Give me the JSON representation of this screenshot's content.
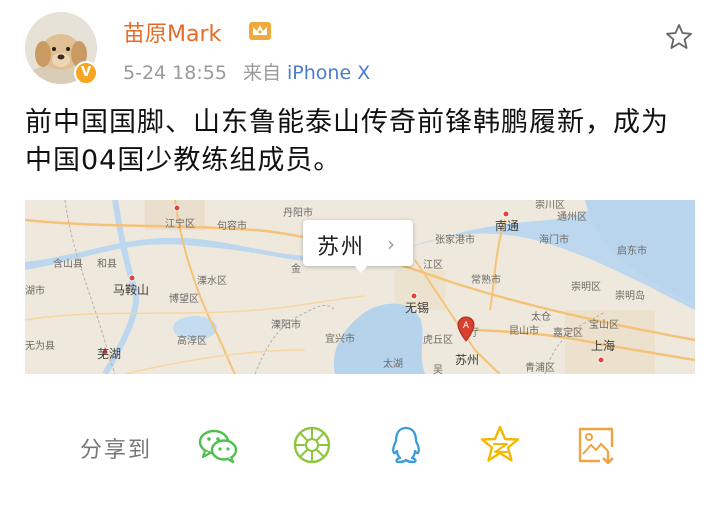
{
  "author": {
    "name": "苗原Mark",
    "verified_badge": "V",
    "badge_color": "#f6a623",
    "name_color": "#e86b24"
  },
  "meta": {
    "time": "5-24 18:55",
    "source_prefix": "来自",
    "source": "iPhone X"
  },
  "post": {
    "text_line1": "前中国国脚、山东鲁能泰山传奇前锋韩鹏履新，成为",
    "text_line2": "中国04国少教练组成员。"
  },
  "map": {
    "location": "苏州",
    "chevron": "›",
    "pin_letter": "A",
    "labels": {
      "nanjing": "江宁区",
      "jurong": "句容市",
      "danyang": "丹阳市",
      "chongchuan": "崇川区",
      "hanshan": "含山县",
      "hexian": "和县",
      "maanshan": "马鞍山",
      "lishui": "溧水区",
      "bowang": "博望区",
      "liyang": "溧阳市",
      "gaochun": "高淳区",
      "wuhu": "芜湖",
      "wuwei": "无为县",
      "hu": "湖市",
      "zhangjiagang": "张家港市",
      "nantong": "南通",
      "haimen": "海门市",
      "qidong": "启东市",
      "tongzhou": "通州区",
      "changshu": "常熟市",
      "wuxi": "无锡",
      "yixing": "宜兴市",
      "taihu": "太湖",
      "huqiu": "虎丘区",
      "suzhou": "苏州",
      "kunshan": "昆山市",
      "jiading": "嘉定区",
      "baoshan": "宝山区",
      "chongming": "崇明区",
      "chongmingdao": "崇明岛",
      "taicang": "太仓",
      "shanghai": "上海",
      "jin": "金",
      "wu": "吴",
      "jiang": "江区",
      "ting": "厅",
      "qingpu": "青浦区"
    }
  },
  "share": {
    "label": "分享到"
  },
  "icons": {
    "star": "star-outline-icon",
    "wechat": "wechat-icon",
    "moments": "wechat-moments-icon",
    "qq": "qq-icon",
    "qzone": "qzone-icon",
    "save": "save-image-icon"
  },
  "colors": {
    "share_green": "#4cc14b",
    "moments_green": "#8dc63f",
    "qq_blue": "#3b9bdc",
    "qzone_yellow": "#f5b800",
    "save_orange": "#f0a340"
  }
}
